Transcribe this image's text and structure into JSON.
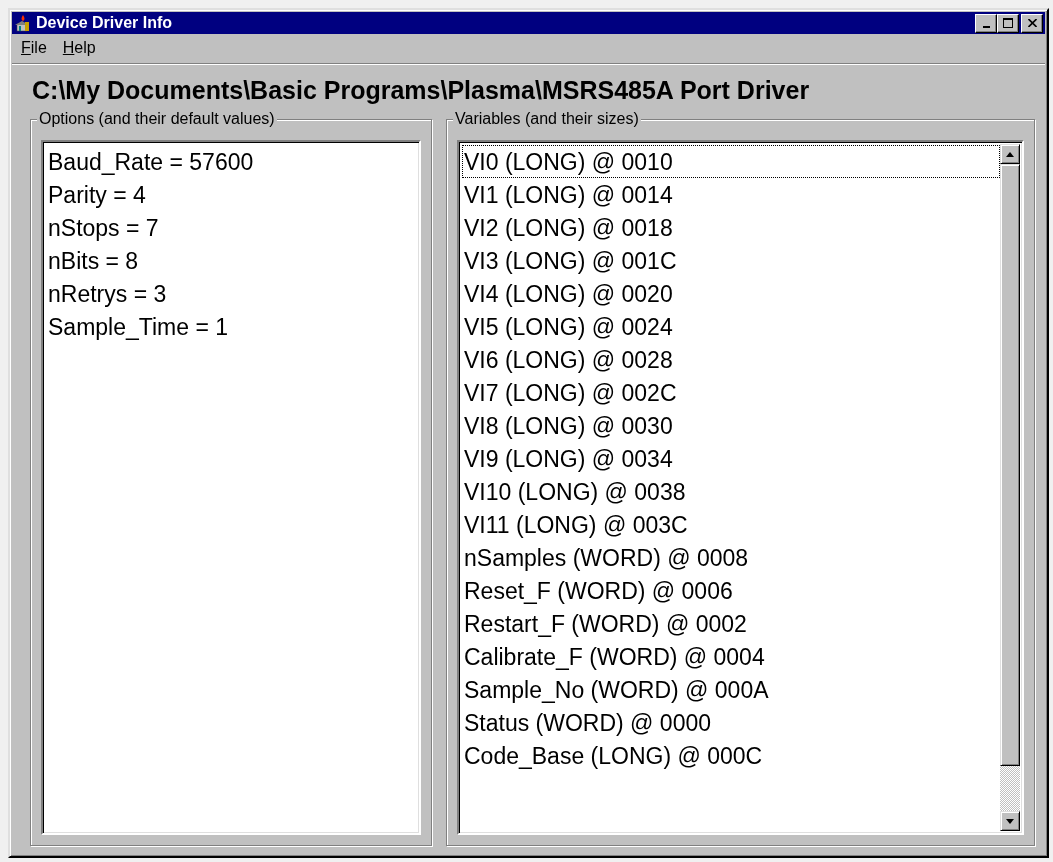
{
  "window": {
    "title": "Device Driver Info"
  },
  "menu": [
    {
      "label": "File"
    },
    {
      "label": "Help"
    }
  ],
  "path": "C:\\My Documents\\Basic Programs\\Plasma\\MSRS485A Port Driver",
  "options": {
    "title": "Options (and their default values)",
    "items": [
      "Baud_Rate = 57600",
      "Parity = 4",
      "nStops = 7",
      "nBits = 8",
      "nRetrys = 3",
      "Sample_Time = 1"
    ]
  },
  "variables": {
    "title": "Variables (and their sizes)",
    "items": [
      {
        "text": "VI0 (LONG) @ 0010",
        "selected": true
      },
      {
        "text": "VI1 (LONG) @ 0014",
        "selected": false
      },
      {
        "text": "VI2 (LONG) @ 0018",
        "selected": false
      },
      {
        "text": "VI3 (LONG) @ 001C",
        "selected": false
      },
      {
        "text": "VI4 (LONG) @ 0020",
        "selected": false
      },
      {
        "text": "VI5 (LONG) @ 0024",
        "selected": false
      },
      {
        "text": "VI6 (LONG) @ 0028",
        "selected": false
      },
      {
        "text": "VI7 (LONG) @ 002C",
        "selected": false
      },
      {
        "text": "VI8 (LONG) @ 0030",
        "selected": false
      },
      {
        "text": "VI9 (LONG) @ 0034",
        "selected": false
      },
      {
        "text": "VI10 (LONG) @ 0038",
        "selected": false
      },
      {
        "text": "VI11 (LONG) @ 003C",
        "selected": false
      },
      {
        "text": "nSamples (WORD) @ 0008",
        "selected": false
      },
      {
        "text": "Reset_F (WORD) @ 0006",
        "selected": false
      },
      {
        "text": "Restart_F (WORD) @ 0002",
        "selected": false
      },
      {
        "text": "Calibrate_F (WORD) @ 0004",
        "selected": false
      },
      {
        "text": "Sample_No (WORD) @ 000A",
        "selected": false
      },
      {
        "text": "Status (WORD) @ 0000",
        "selected": false
      },
      {
        "text": "Code_Base (LONG) @ 000C",
        "selected": false
      }
    ]
  }
}
